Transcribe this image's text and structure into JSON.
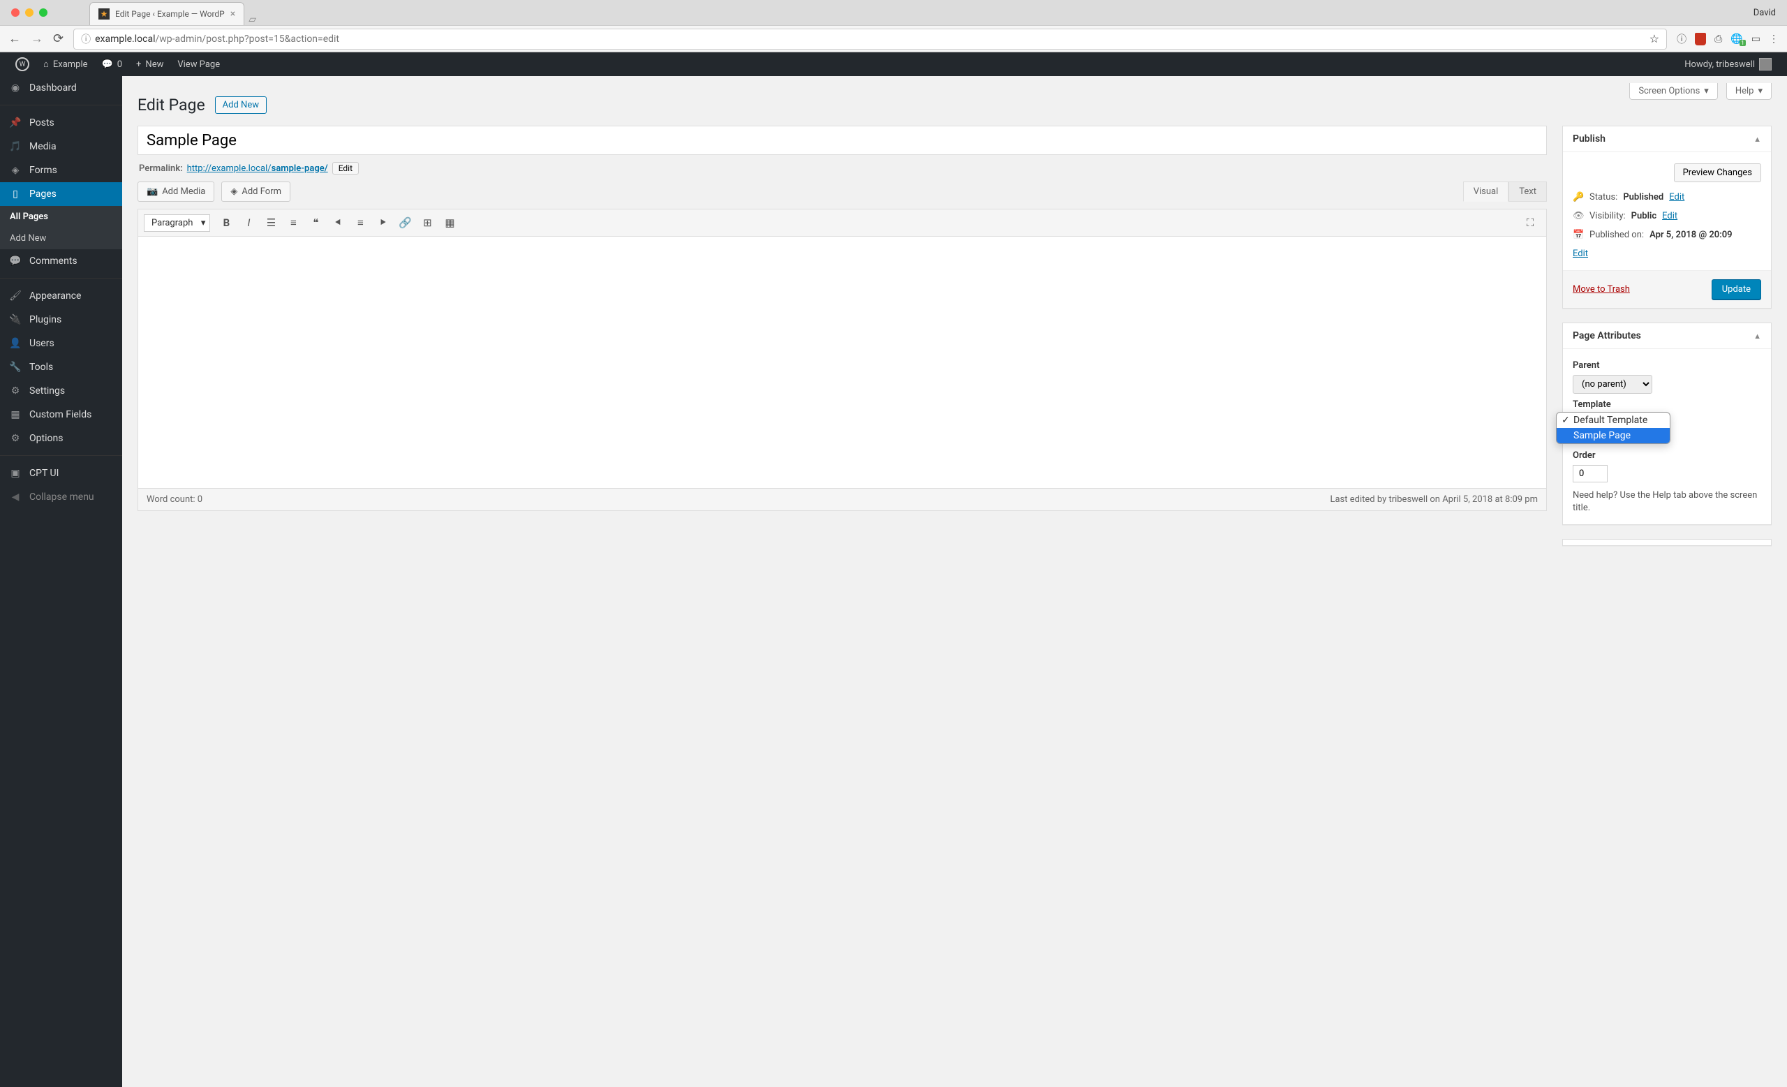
{
  "browser": {
    "tab_title": "Edit Page ‹ Example — WordP",
    "user": "David",
    "url_prefix": "example.local",
    "url_path": "/wp-admin/post.php?post=15&action=edit"
  },
  "admin_bar": {
    "site_name": "Example",
    "comments": "0",
    "new": "New",
    "view": "View Page",
    "howdy": "Howdy, tribeswell"
  },
  "sidebar": {
    "items": [
      {
        "label": "Dashboard",
        "icon": "dashboard"
      },
      {
        "label": "Posts",
        "icon": "pin"
      },
      {
        "label": "Media",
        "icon": "media"
      },
      {
        "label": "Forms",
        "icon": "forms"
      },
      {
        "label": "Pages",
        "icon": "page",
        "current": true
      },
      {
        "label": "Comments",
        "icon": "comment"
      },
      {
        "label": "Appearance",
        "icon": "brush"
      },
      {
        "label": "Plugins",
        "icon": "plugin"
      },
      {
        "label": "Users",
        "icon": "user"
      },
      {
        "label": "Tools",
        "icon": "wrench"
      },
      {
        "label": "Settings",
        "icon": "settings"
      },
      {
        "label": "Custom Fields",
        "icon": "grid"
      },
      {
        "label": "Options",
        "icon": "gear"
      },
      {
        "label": "CPT UI",
        "icon": "cpt"
      },
      {
        "label": "Collapse menu",
        "icon": "collapse"
      }
    ],
    "submenu": {
      "all": "All Pages",
      "add": "Add New"
    }
  },
  "screen_tabs": {
    "options": "Screen Options",
    "help": "Help"
  },
  "heading": {
    "title": "Edit Page",
    "add_new": "Add New"
  },
  "post": {
    "title": "Sample Page",
    "permalink_label": "Permalink:",
    "permalink_base": "http://example.local/",
    "permalink_slug": "sample-page/",
    "edit": "Edit"
  },
  "editor": {
    "add_media": "Add Media",
    "add_form": "Add Form",
    "tab_visual": "Visual",
    "tab_text": "Text",
    "format": "Paragraph",
    "word_count_label": "Word count: ",
    "word_count": "0",
    "last_edited": "Last edited by tribeswell on April 5, 2018 at 8:09 pm"
  },
  "publish": {
    "title": "Publish",
    "preview": "Preview Changes",
    "status_label": "Status:",
    "status_value": "Published",
    "visibility_label": "Visibility:",
    "visibility_value": "Public",
    "published_label": "Published on:",
    "published_value": "Apr 5, 2018 @ 20:09",
    "edit": "Edit",
    "trash": "Move to Trash",
    "update": "Update"
  },
  "attributes": {
    "title": "Page Attributes",
    "parent_label": "Parent",
    "parent_value": "(no parent)",
    "template_label": "Template",
    "template_options": [
      "Default Template",
      "Sample Page"
    ],
    "order_label": "Order",
    "order_value": "0",
    "help_text": "Need help? Use the Help tab above the screen title."
  }
}
